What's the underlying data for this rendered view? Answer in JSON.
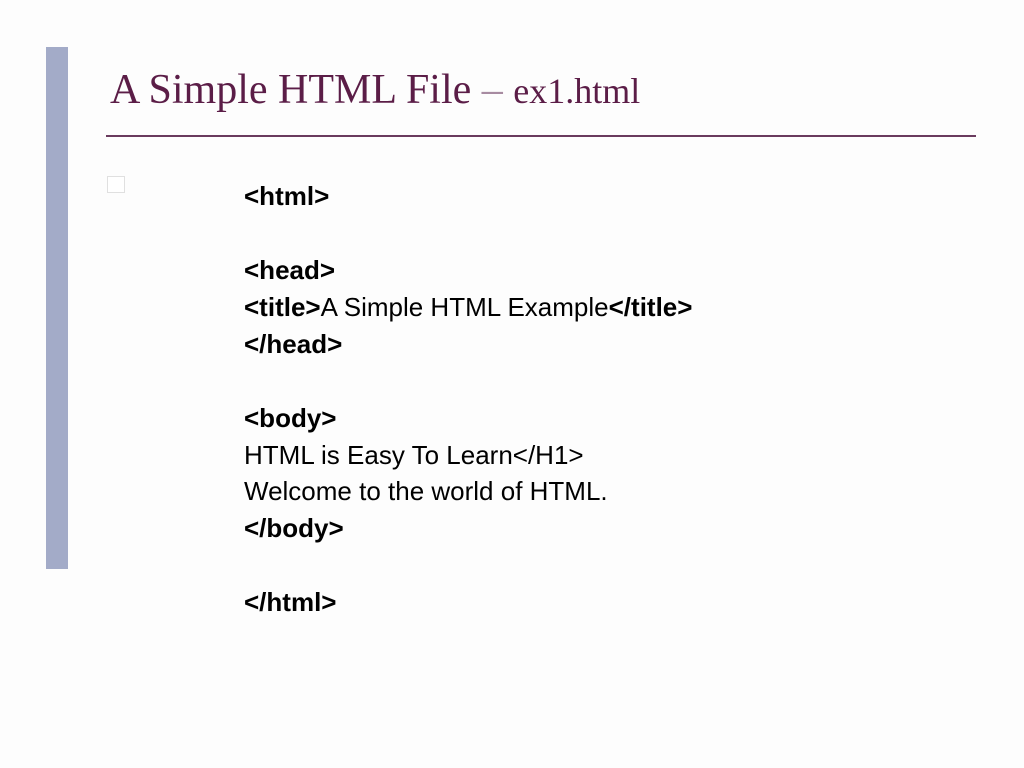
{
  "title": {
    "main": "A Simple HTML File ",
    "dash": "– ",
    "sub": "ex1.html"
  },
  "code": {
    "l1_b": "<html>",
    "l3_b": "<head>",
    "l4_b1": "<title>",
    "l4_txt": "A Simple HTML Example",
    "l4_b2": "</title>",
    "l5_b": "</head>",
    "l7_b": "<body>",
    "l8_txt": "HTML is Easy To Learn</H1>",
    "l9_txt": "Welcome to the world of HTML.",
    "l10_b": "</body>",
    "l12_b": "</html>"
  }
}
